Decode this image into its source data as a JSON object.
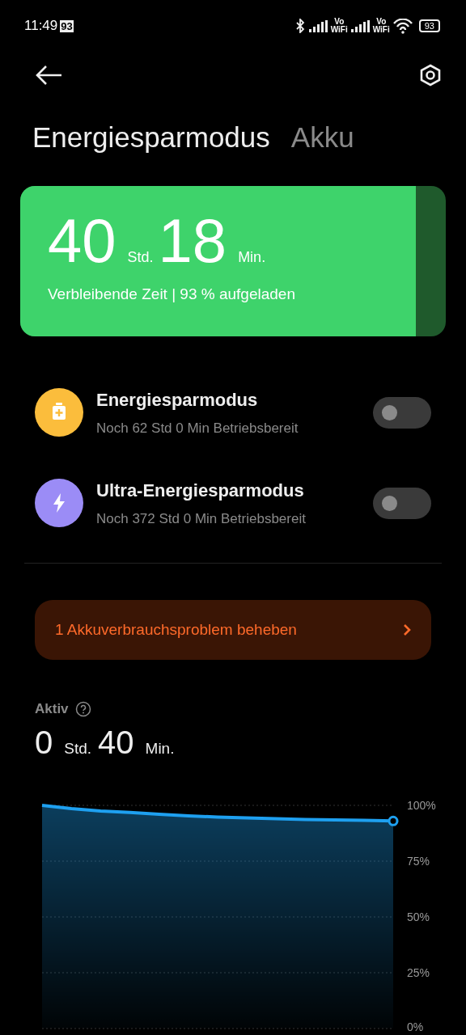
{
  "status_bar": {
    "time": "11:49",
    "notification_badge": "93",
    "network_labels": [
      {
        "top": "Vo",
        "bottom": "WiFi"
      },
      {
        "top": "Vo",
        "bottom": "WiFi"
      }
    ],
    "battery": "93"
  },
  "tabs": [
    {
      "label": "Energiesparmodus",
      "selected": true
    },
    {
      "label": "Akku",
      "selected": false
    }
  ],
  "battery_card": {
    "hours": "40",
    "hours_unit": "Std.",
    "minutes": "18",
    "minutes_unit": "Min.",
    "caption": "Verbleibende Zeit | 93 % aufgeladen",
    "level": 0.93
  },
  "modes": [
    {
      "kind": "saver",
      "title": "Energiesparmodus",
      "subtitle": "Noch 62 Std 0 Min Betriebsbereit",
      "on": false,
      "color": "#fbbd3c"
    },
    {
      "kind": "ultra",
      "title": "Ultra-Energiesparmodus",
      "subtitle": "Noch 372 Std 0 Min Betriebsbereit",
      "on": false,
      "color": "#9b8cf6"
    }
  ],
  "issue_banner": {
    "text": "1 Akkuverbrauchsproblem beheben"
  },
  "active": {
    "label": "Aktiv",
    "hours": "0",
    "hours_unit": "Std.",
    "minutes": "40",
    "minutes_unit": "Min."
  },
  "chart_data": {
    "type": "area",
    "series": [
      {
        "color": "#1ea0f0",
        "values": [
          100,
          98.5,
          97.5,
          96.8,
          96,
          95.3,
          94.8,
          94.4,
          94,
          93.7,
          93.5,
          93.3,
          93
        ]
      }
    ],
    "ylim": [
      0,
      100
    ],
    "grid": true,
    "yticks": [
      {
        "value": 100,
        "label": "100%"
      },
      {
        "value": 75,
        "label": "75%"
      },
      {
        "value": 50,
        "label": "50%"
      },
      {
        "value": 25,
        "label": "25%"
      },
      {
        "value": 0,
        "label": "0%"
      }
    ]
  }
}
